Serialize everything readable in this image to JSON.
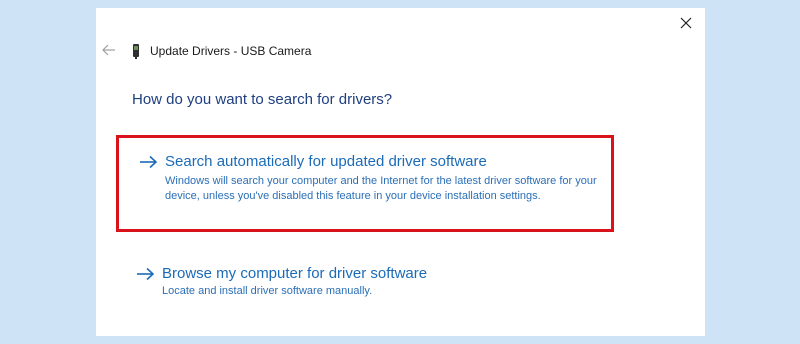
{
  "window": {
    "title": "Update Drivers - USB Camera"
  },
  "heading": "How do you want to search for drivers?",
  "options": [
    {
      "title": "Search automatically for updated driver software",
      "description": "Windows will search your computer and the Internet for the latest driver software for your device, unless you've disabled this feature in your device installation settings.",
      "highlighted": true
    },
    {
      "title": "Browse my computer for driver software",
      "description": "Locate and install driver software manually.",
      "highlighted": false
    }
  ],
  "icons": {
    "close": "close-icon",
    "back": "back-arrow-icon",
    "device": "usb-device-icon",
    "option_arrow": "right-arrow-icon"
  },
  "colors": {
    "background": "#cfe3f6",
    "dialog": "#ffffff",
    "heading": "#1e3f80",
    "link": "#1b6bb8",
    "highlight_border": "#d9121b"
  }
}
